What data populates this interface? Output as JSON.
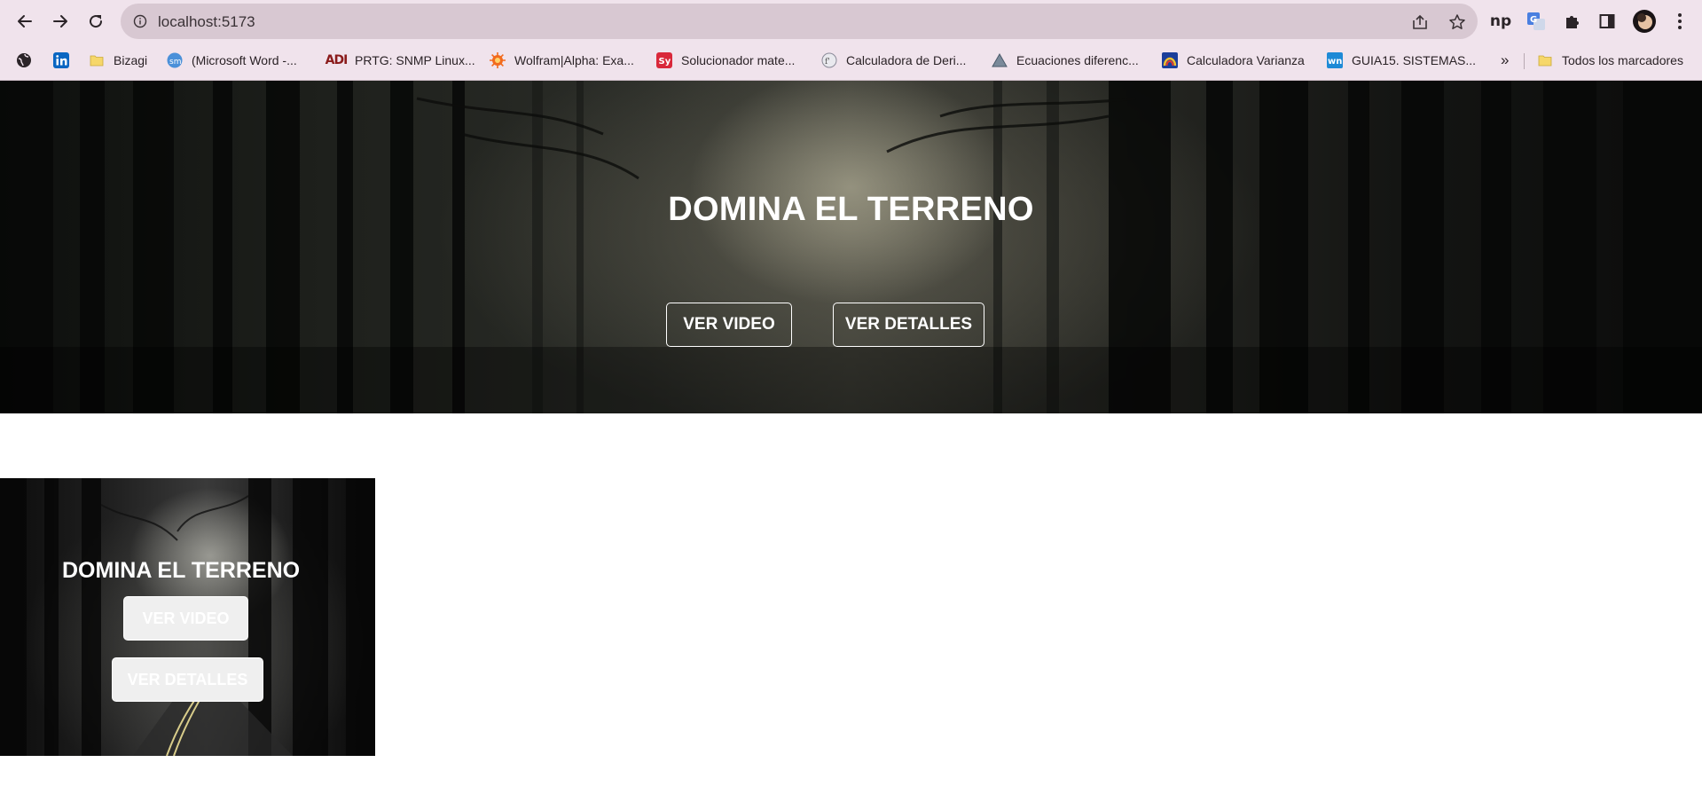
{
  "browser": {
    "url": "localhost:5173",
    "colors": {
      "frame": "#f0e3ec",
      "omnibox": "#d8c8d2"
    },
    "toolbar_icons": [
      "back-icon",
      "forward-icon",
      "reload-icon",
      "site-info-icon",
      "share-icon",
      "bookmark-star-icon"
    ],
    "extensions": [
      "np-extension-icon",
      "translate-extension-icon",
      "puzzle-icon",
      "side-panel-icon",
      "profile-avatar",
      "menu-kebab-icon"
    ],
    "bookmarks": [
      {
        "label": "",
        "icon": "globe-icon"
      },
      {
        "label": "",
        "icon": "linkedin-icon"
      },
      {
        "label": "Bizagi",
        "icon": "folder-icon"
      },
      {
        "label": "(Microsoft Word -...",
        "icon": "sm-icon"
      },
      {
        "label": "PRTG: SNMP Linux...",
        "icon": "prtg-icon"
      },
      {
        "label": "Wolfram|Alpha: Exa...",
        "icon": "wolfram-icon"
      },
      {
        "label": "Solucionador mate...",
        "icon": "symbolab-icon"
      },
      {
        "label": "Calculadora de Deri...",
        "icon": "derivative-icon"
      },
      {
        "label": "Ecuaciones diferenc...",
        "icon": "triangle-icon"
      },
      {
        "label": "Calculadora Varianza",
        "icon": "rainbow-icon"
      },
      {
        "label": "GUIA15. SISTEMAS...",
        "icon": "wn-icon"
      }
    ],
    "more_bookmarks": "»",
    "all_bookmarks": "Todos los marcadores"
  },
  "hero": {
    "title": "DOMINA EL TERRENO",
    "buttons": [
      "VER VIDEO",
      "VER DETALLES"
    ]
  },
  "card": {
    "title": "DOMINA EL TERRENO",
    "buttons": [
      "VER VIDEO",
      "VER DETALLES"
    ]
  }
}
